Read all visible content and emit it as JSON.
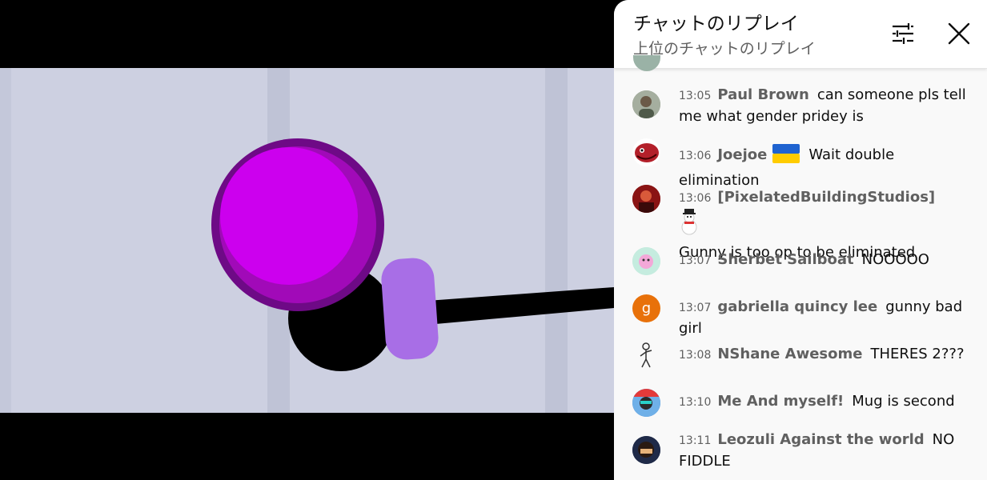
{
  "chat": {
    "title": "チャットのリプレイ",
    "subtitle": "上位のチャットのリプレイ",
    "filter_icon": "tune-sliders-icon",
    "close_icon": "close-icon",
    "messages": [
      {
        "time": "13:05",
        "author": "Paul Brown",
        "text": "can someone pls tell me what gender pridey is",
        "avatar_color": "#8d9a8a"
      },
      {
        "time": "13:06",
        "author": "Joejoe",
        "author_emoji": "flag-ukraine",
        "text": "Wait double elimination",
        "avatar_color": "#b3202a"
      },
      {
        "time": "13:06",
        "author": "[PixelatedBuildingStudios]",
        "author_emoji": "snowman",
        "text": "Gunny is too op to be eliminated",
        "avatar_color": "#7a1010"
      },
      {
        "time": "13:07",
        "author": "Sherbet Sailboat",
        "text": "NOOOOO",
        "avatar_color": "#bfe8d8"
      },
      {
        "time": "13:07",
        "author": "gabriella quincy lee",
        "text": "gunny bad girl",
        "avatar_color": "#e8710a",
        "avatar_letter": "g"
      },
      {
        "time": "13:08",
        "author": "NShane Awesome",
        "text": "THERES 2???",
        "avatar_color": "#f9f9f9"
      },
      {
        "time": "13:10",
        "author": "Me And myself!",
        "text": "Mug is second",
        "avatar_color": "#3b78c8"
      },
      {
        "time": "13:11",
        "author": "Leozuli Against the world",
        "text": "NO FIDDLE",
        "avatar_color": "#1f2a48"
      }
    ]
  },
  "video": {
    "background_color": "#cdd0e1",
    "ball_color": "#cc00ee",
    "handle_color": "#a86ee6"
  }
}
